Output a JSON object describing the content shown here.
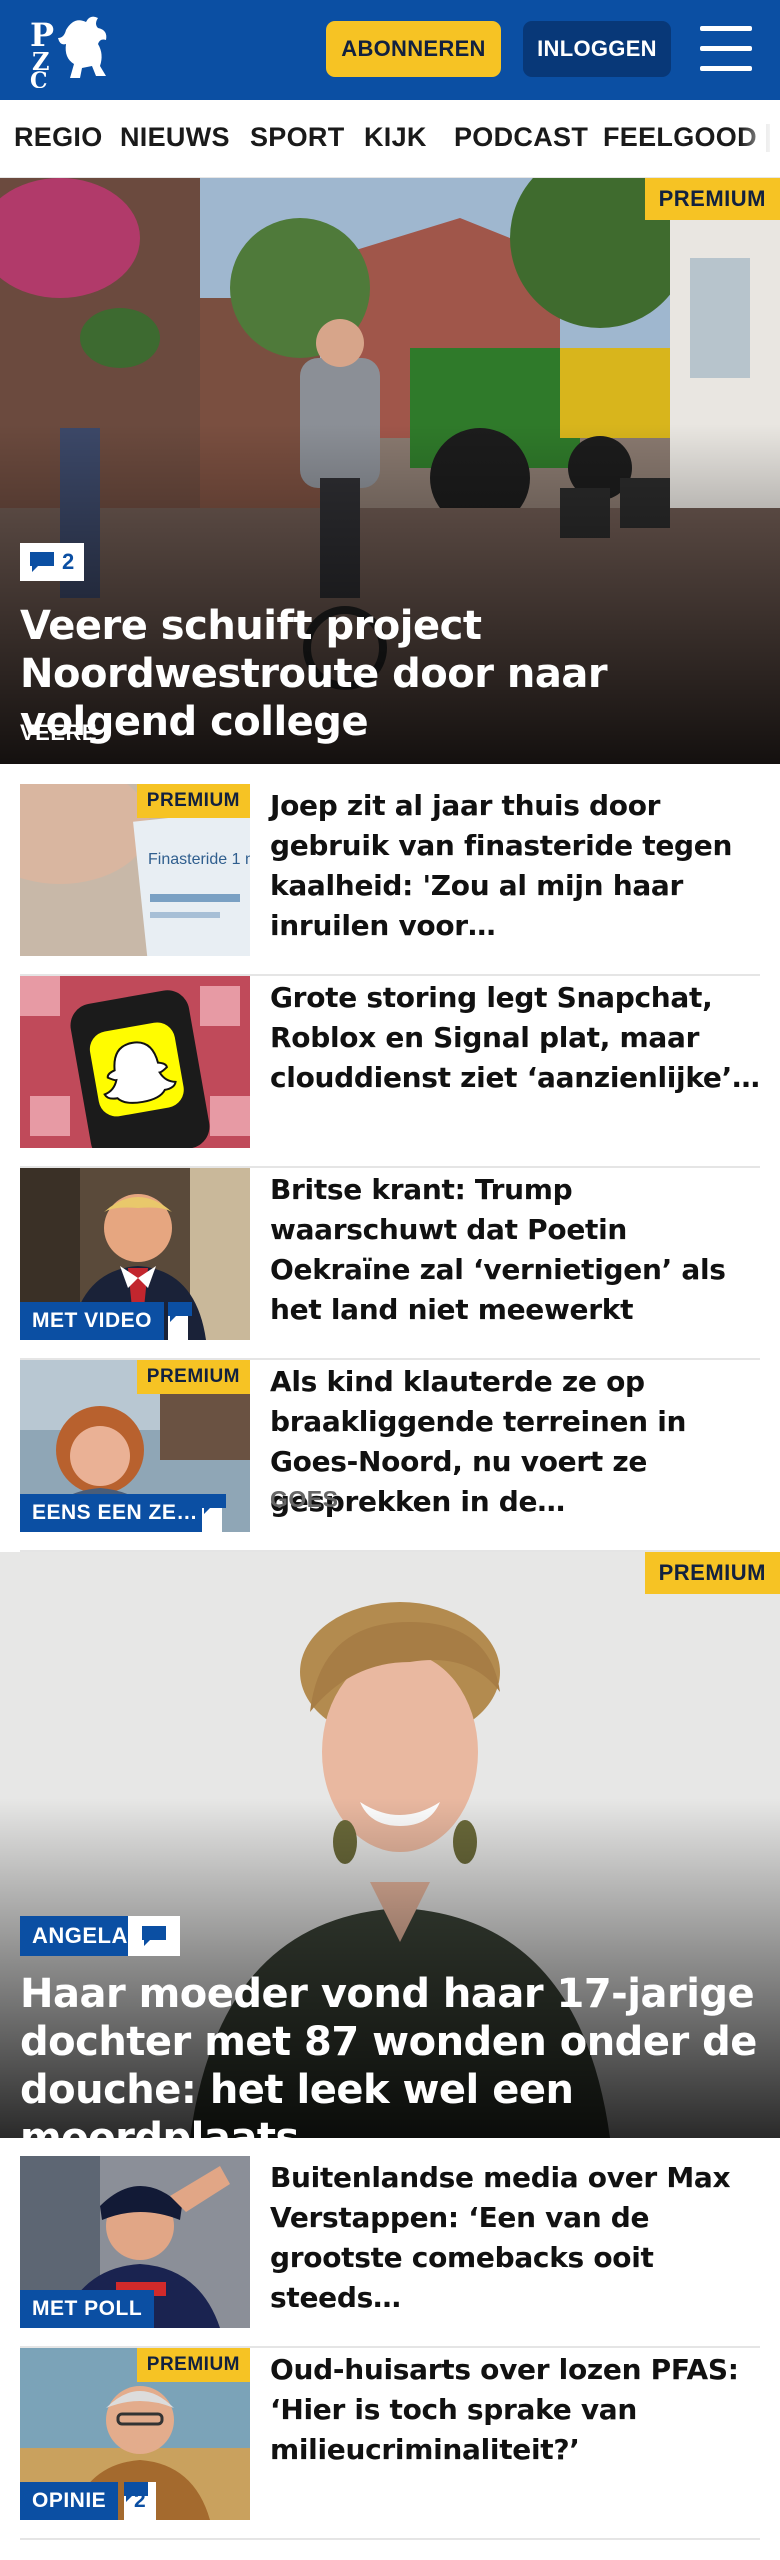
{
  "header": {
    "logo_text": "PZC",
    "subscribe_label": "ABONNEREN",
    "login_label": "INLOGGEN",
    "menu_icon": "hamburger-menu-icon"
  },
  "nav": {
    "items": [
      "REGIO",
      "NIEUWS",
      "SPORT",
      "KIJK",
      "PODCAST",
      "FEELGOOD"
    ]
  },
  "articles": {
    "hero1": {
      "badge": "PREMIUM",
      "comments": "2",
      "title": "Veere schuift project Noordwestroute door naar volgend college",
      "label": "VEERE"
    },
    "item1": {
      "badge": "PREMIUM",
      "title": "Joep zit al jaar thuis door gebruik van finasteride tegen kaalheid: 'Zou al mijn haar inruilen voor…"
    },
    "item2": {
      "title": "Grote storing legt Snapchat, Roblox en Signal plat, maar clouddienst ziet ‘aanzienlijke’…"
    },
    "item3": {
      "tag": "MET VIDEO",
      "title": "Britse krant: Trump waarschuwt dat Poetin Oekraïne zal ‘vernieti­gen’ als het land niet meewerkt"
    },
    "item4": {
      "badge": "PREMIUM",
      "tag": "EENS EEN ZE…",
      "title": "Als kind klauterde ze op braaklig­gende terreinen in Goes-Noord, nu voert ze gesprekken in de…",
      "label": "GOES"
    },
    "hero2": {
      "badge": "PREMIUM",
      "tag": "ANGELA",
      "title": "Haar moeder vond haar 17-jarige dochter met 87 wonden onder de douche: het leek wel een moordplaats"
    },
    "item5": {
      "tag": "MET POLL",
      "title": "Buitenlandse media over Max Verstappen: ‘Een van de grootste comebacks ooit steeds…"
    },
    "item6": {
      "badge": "PREMIUM",
      "tag": "OPINIE",
      "comments": "2",
      "title": "Oud-huisarts over lozen PFAS: ‘Hier is toch sprake van milieucri­minaliteit?’"
    }
  },
  "colors": {
    "brand_blue": "#0b4fa3",
    "premium_yellow": "#f6c324",
    "login_blue": "#083878"
  }
}
